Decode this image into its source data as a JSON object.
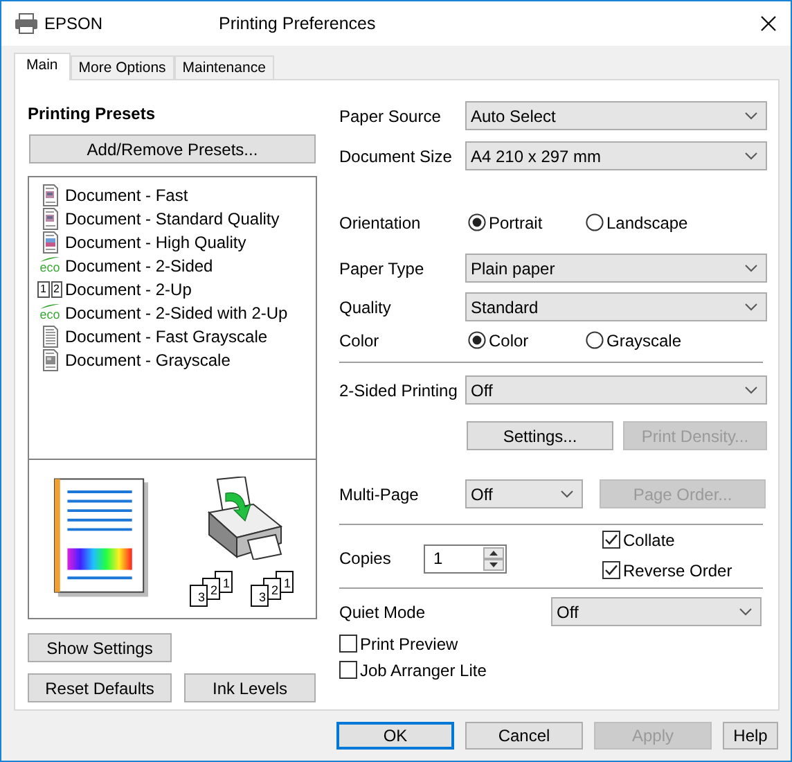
{
  "window": {
    "brand": "EPSON",
    "title": "Printing Preferences"
  },
  "tabs": [
    {
      "label": "Main",
      "selected": true
    },
    {
      "label": "More Options",
      "selected": false
    },
    {
      "label": "Maintenance",
      "selected": false
    }
  ],
  "presets": {
    "title": "Printing Presets",
    "add_button": "Add/Remove Presets...",
    "items": [
      {
        "kind": "document",
        "label": "Document - Fast"
      },
      {
        "kind": "document",
        "label": "Document - Standard Quality"
      },
      {
        "kind": "photo",
        "label": "Document - High Quality"
      },
      {
        "kind": "eco",
        "badge": "eco",
        "label": "Document - 2-Sided"
      },
      {
        "kind": "tiles",
        "tiles": [
          "1",
          "2"
        ],
        "label": "Document - 2-Up"
      },
      {
        "kind": "eco",
        "badge": "eco",
        "label": "Document - 2-Sided with 2-Up"
      },
      {
        "kind": "gray",
        "label": "Document - Fast Grayscale"
      },
      {
        "kind": "gray-photo",
        "label": "Document - Grayscale"
      }
    ]
  },
  "preview": {
    "stacks": [
      [
        "3",
        "2",
        "1"
      ],
      [
        "3",
        "2",
        "1"
      ]
    ]
  },
  "left_buttons": [
    {
      "label": "Show Settings"
    },
    {
      "label": "Reset Defaults"
    },
    {
      "label": "Ink Levels"
    }
  ],
  "paper_source": {
    "label": "Paper Source",
    "value": "Auto Select"
  },
  "document_size": {
    "label": "Document Size",
    "value": "A4 210 x 297 mm"
  },
  "orientation": {
    "label": "Orientation",
    "options": [
      {
        "label": "Portrait",
        "selected": true
      },
      {
        "label": "Landscape",
        "selected": false
      }
    ]
  },
  "paper_type": {
    "label": "Paper Type",
    "value": "Plain paper"
  },
  "quality": {
    "label": "Quality",
    "value": "Standard"
  },
  "color": {
    "label": "Color",
    "options": [
      {
        "label": "Color",
        "selected": true
      },
      {
        "label": "Grayscale",
        "selected": false
      }
    ]
  },
  "two_sided": {
    "label": "2-Sided Printing",
    "value": "Off",
    "buttons": [
      {
        "label": "Settings...",
        "disabled": false
      },
      {
        "label": "Print Density...",
        "disabled": true
      }
    ]
  },
  "multi_page": {
    "label": "Multi-Page",
    "value": "Off",
    "button": {
      "label": "Page Order...",
      "disabled": true
    }
  },
  "copies": {
    "label": "Copies",
    "value": "1"
  },
  "copy_options": [
    {
      "label": "Collate",
      "checked": true
    },
    {
      "label": "Reverse Order",
      "checked": true
    }
  ],
  "quiet_mode": {
    "label": "Quiet Mode",
    "value": "Off"
  },
  "job_options": [
    {
      "label": "Print Preview",
      "checked": false
    },
    {
      "label": "Job Arranger Lite",
      "checked": false
    }
  ],
  "footer_buttons": [
    {
      "label": "OK",
      "default": true,
      "disabled": false
    },
    {
      "label": "Cancel",
      "default": false,
      "disabled": false
    },
    {
      "label": "Apply",
      "default": false,
      "disabled": true
    },
    {
      "label": "Help",
      "default": false,
      "disabled": false
    }
  ]
}
